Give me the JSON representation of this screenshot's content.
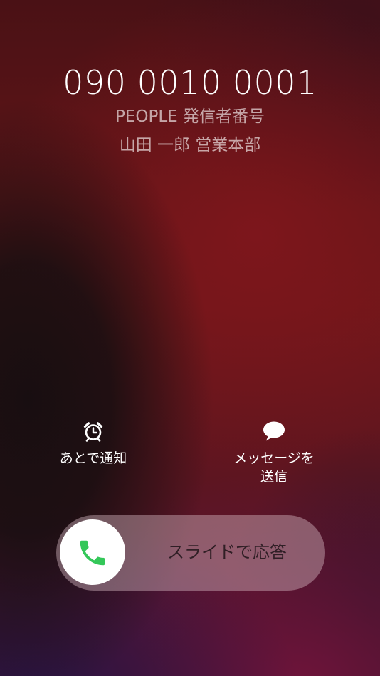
{
  "caller": {
    "number": "090 0010 0001",
    "source": "PEOPLE 発信者番号",
    "name": "山田 一郎 営業本部"
  },
  "actions": {
    "remind": {
      "label": "あとで通知",
      "icon": "alarm-clock-icon"
    },
    "message": {
      "label_line1": "メッセージを",
      "label_line2": "送信",
      "icon": "speech-bubble-icon"
    }
  },
  "slider": {
    "label": "スライドで応答",
    "icon": "phone-icon",
    "icon_color": "#34c759"
  }
}
